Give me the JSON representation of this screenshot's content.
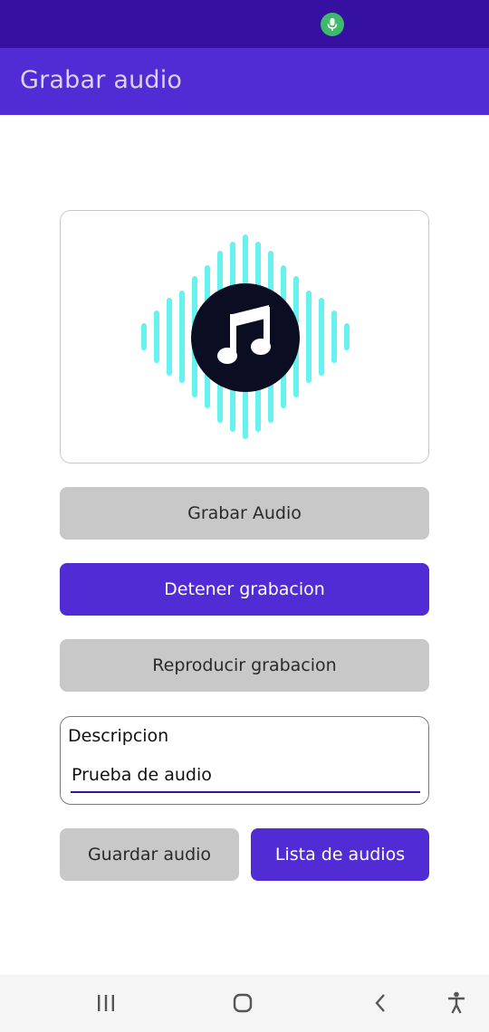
{
  "status_bar": {
    "indicator_icon": "microphone-icon",
    "indicator_color": "#3dba6a"
  },
  "app_bar": {
    "title": "Grabar audio",
    "color": "#512bd4"
  },
  "media": {
    "icon": "music-note-icon",
    "wave_color": "#66f2ee"
  },
  "buttons": {
    "record": "Grabar Audio",
    "stop": "Detener grabacion",
    "play": "Reproducir grabacion",
    "save": "Guardar audio",
    "list": "Lista de audios"
  },
  "description": {
    "label": "Descripcion",
    "value": "Prueba de audio"
  },
  "nav_bar": {
    "recents_icon": "recent-apps-icon",
    "home_icon": "home-icon",
    "back_icon": "back-icon",
    "accessibility_icon": "accessibility-icon"
  },
  "colors": {
    "accent": "#512bd4",
    "status_bar": "#3610a0",
    "button_gray": "#c8c8c8"
  }
}
